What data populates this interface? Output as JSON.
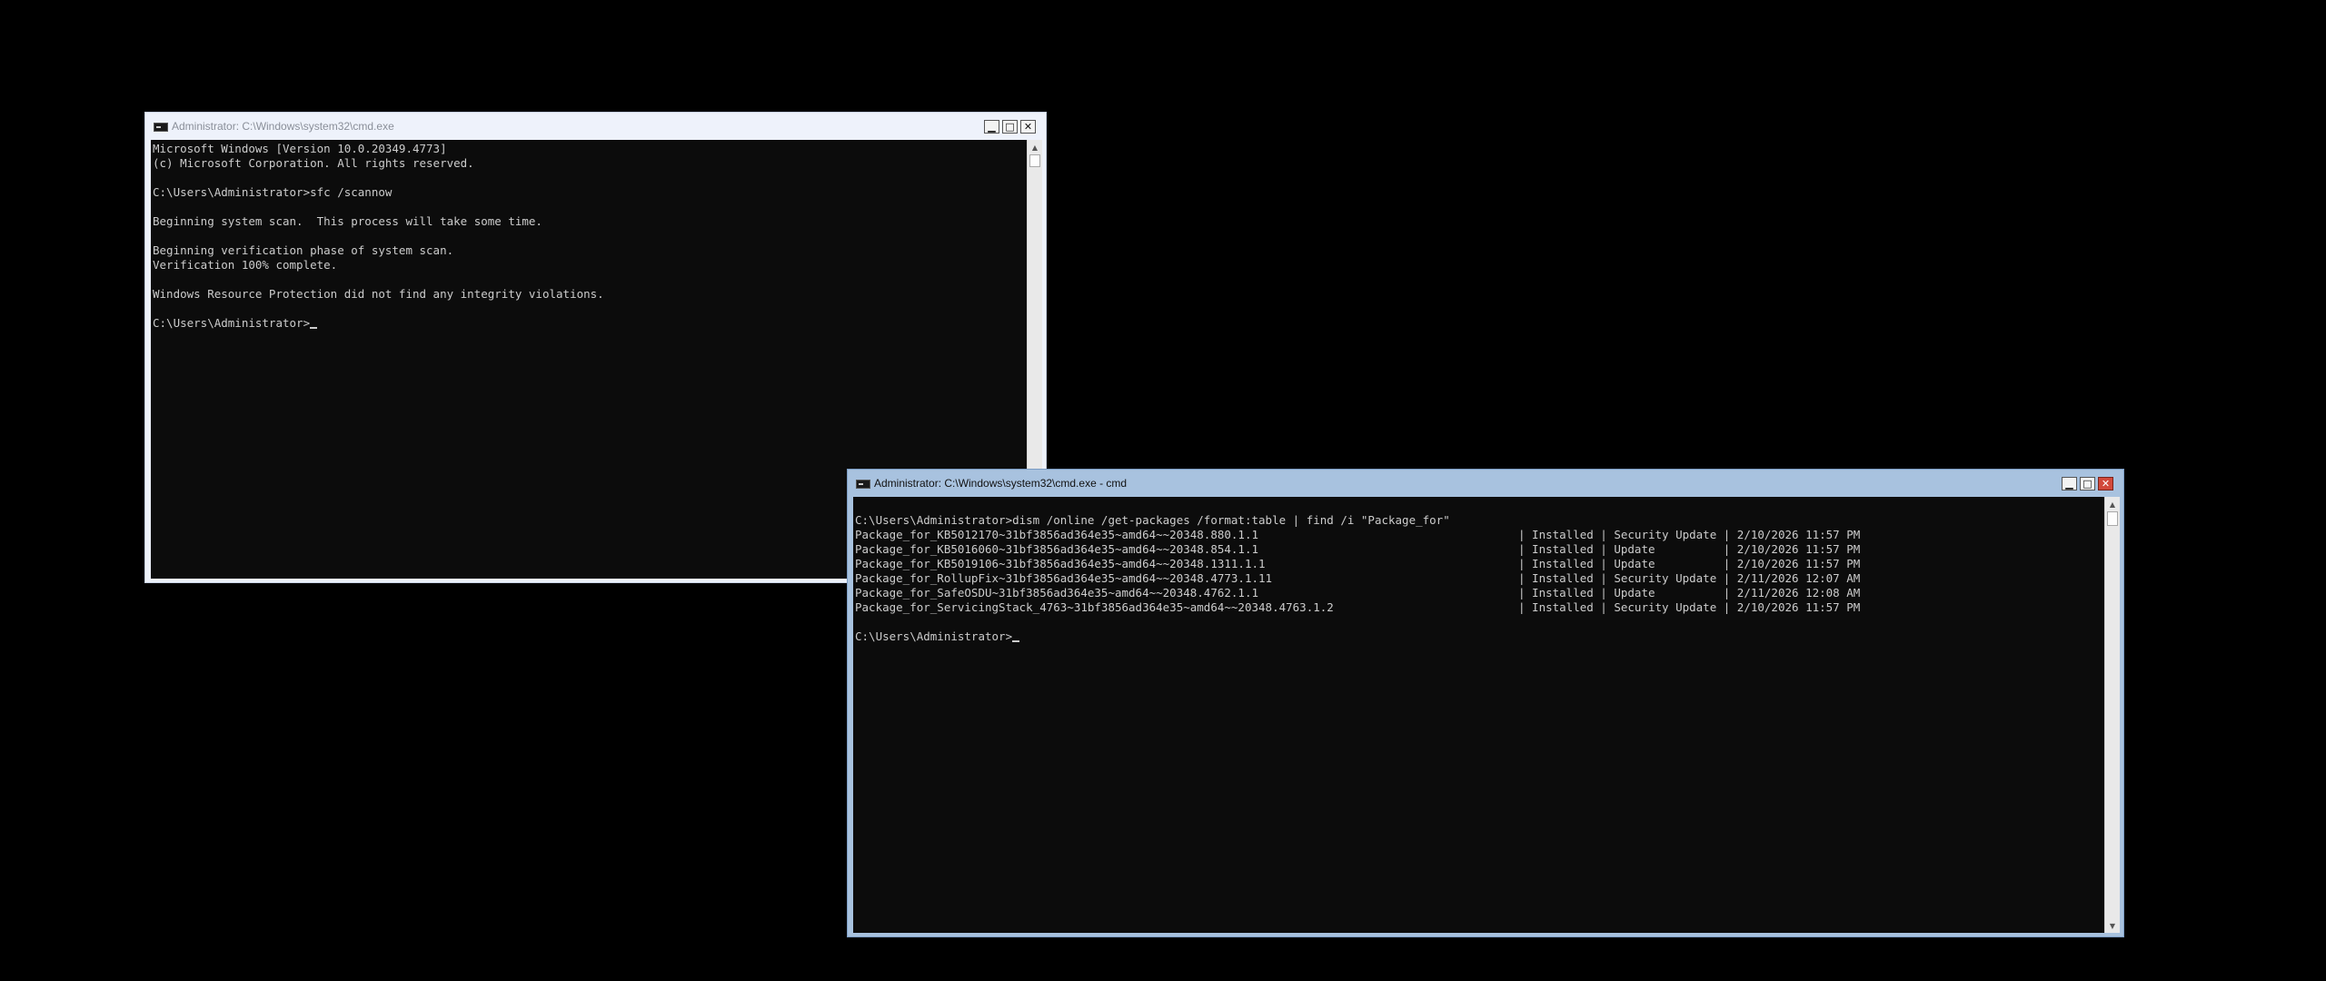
{
  "window1": {
    "title": "Administrator: C:\\Windows\\system32\\cmd.exe",
    "lines": [
      "Microsoft Windows [Version 10.0.20349.4773]",
      "(c) Microsoft Corporation. All rights reserved.",
      "",
      "C:\\Users\\Administrator>sfc /scannow",
      "",
      "Beginning system scan.  This process will take some time.",
      "",
      "Beginning verification phase of system scan.",
      "Verification 100% complete.",
      "",
      "Windows Resource Protection did not find any integrity violations.",
      ""
    ],
    "prompt": "C:\\Users\\Administrator>"
  },
  "window2": {
    "title": "Administrator: C:\\Windows\\system32\\cmd.exe - cmd",
    "lines": [
      "",
      "C:\\Users\\Administrator>dism /online /get-packages /format:table | find /i \"Package_for\"",
      "Package_for_KB5012170~31bf3856ad364e35~amd64~~20348.880.1.1                                      | Installed | Security Update | 2/10/2026 11:57 PM",
      "Package_for_KB5016060~31bf3856ad364e35~amd64~~20348.854.1.1                                      | Installed | Update          | 2/10/2026 11:57 PM",
      "Package_for_KB5019106~31bf3856ad364e35~amd64~~20348.1311.1.1                                     | Installed | Update          | 2/10/2026 11:57 PM",
      "Package_for_RollupFix~31bf3856ad364e35~amd64~~20348.4773.1.11                                    | Installed | Security Update | 2/11/2026 12:07 AM",
      "Package_for_SafeOSDU~31bf3856ad364e35~amd64~~20348.4762.1.1                                      | Installed | Update          | 2/11/2026 12:08 AM",
      "Package_for_ServicingStack_4763~31bf3856ad364e35~amd64~~20348.4763.1.2                           | Installed | Security Update | 2/10/2026 11:57 PM",
      ""
    ],
    "prompt": "C:\\Users\\Administrator>"
  },
  "controls": {
    "minimize_glyph": "▁",
    "maximize_glyph": "□",
    "close_glyph": "✕"
  },
  "scroll": {
    "up_glyph": "▲",
    "down_glyph": "▼"
  }
}
